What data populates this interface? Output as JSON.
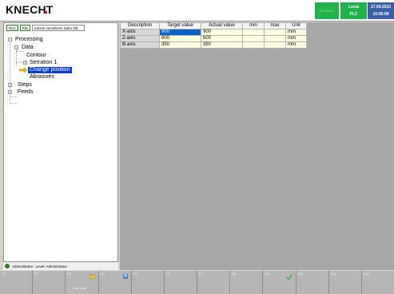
{
  "header": {
    "logo": "KNECHT",
    "mode": "MANUAL",
    "local_line1": "Local",
    "local_line2": "PLC",
    "date": "27.09.2023",
    "time": "10:05:08"
  },
  "toolbar": {
    "plc_label": "PLC",
    "file_label": "File",
    "program_name": "messe verzahnen Zahn 3/5"
  },
  "tree": {
    "processing": "Processing",
    "data": "Data",
    "contour": "Contour",
    "serration": "Serration 1",
    "change_position": "Change position",
    "abrasives": "Abrasives",
    "steps": "Steps",
    "feeds": "Feeds"
  },
  "table": {
    "headers": [
      "Description",
      "Target value",
      "Actual value",
      "min",
      "max",
      "Unit"
    ],
    "rows": [
      {
        "description": "X-axis",
        "target": "900",
        "actual": "900",
        "min": "",
        "max": "",
        "unit": "mm"
      },
      {
        "description": "Z-axis",
        "target": "600",
        "actual": "600",
        "min": "",
        "max": "",
        "unit": "mm"
      },
      {
        "description": "B-axis",
        "target": "350",
        "actual": "350",
        "min": "",
        "max": "",
        "unit": "mm"
      }
    ]
  },
  "status": {
    "user": "Administrator",
    "level": "Level: Administrator"
  },
  "fkeys": [
    {
      "num": "F1",
      "label": ""
    },
    {
      "num": "F2",
      "label": ""
    },
    {
      "num": "F3",
      "label": "Load  from"
    },
    {
      "num": "F4",
      "label": ""
    },
    {
      "num": "F5",
      "label": ""
    },
    {
      "num": "F6",
      "label": ""
    },
    {
      "num": "F7",
      "label": ""
    },
    {
      "num": "F8",
      "label": ""
    },
    {
      "num": "F9",
      "label": ""
    },
    {
      "num": "F10",
      "label": ""
    },
    {
      "num": "F11",
      "label": ""
    },
    {
      "num": "F12",
      "label": ""
    }
  ]
}
